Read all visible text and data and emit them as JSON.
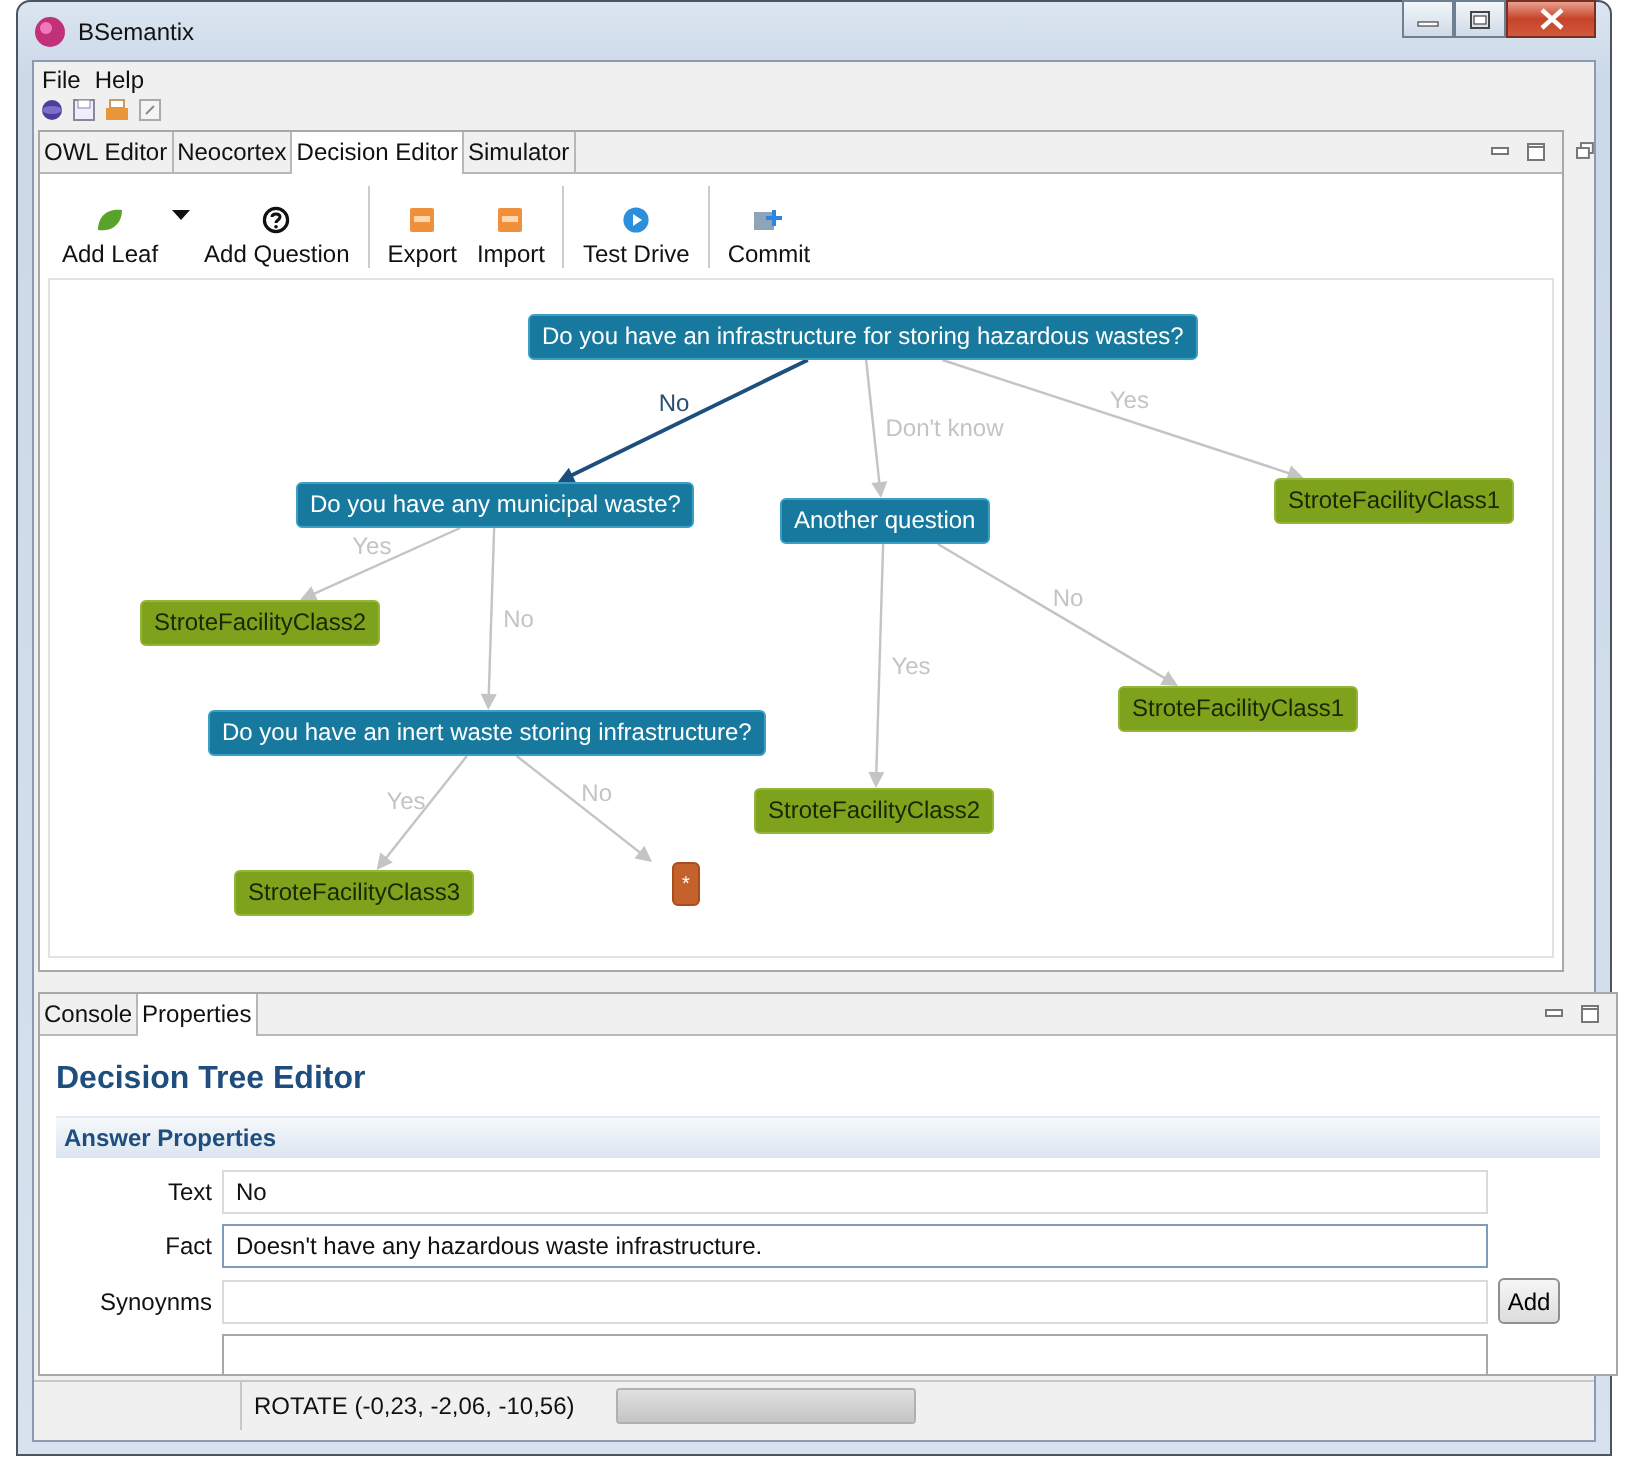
{
  "window": {
    "title": "BSemantix"
  },
  "menu": [
    "File",
    "Help"
  ],
  "editor_tabs": [
    {
      "label": "OWL Editor",
      "selected": false
    },
    {
      "label": "Neocortex",
      "selected": false
    },
    {
      "label": "Decision Editor",
      "selected": true
    },
    {
      "label": "Simulator",
      "selected": false
    }
  ],
  "toolbar": [
    {
      "items": [
        {
          "label": "Add Leaf",
          "dropdown": true
        },
        {
          "label": "Add Question",
          "dropdown": false
        }
      ]
    },
    {
      "items": [
        {
          "label": "Export",
          "dropdown": false
        },
        {
          "label": "Import",
          "dropdown": false
        }
      ]
    },
    {
      "items": [
        {
          "label": "Test Drive",
          "dropdown": false
        }
      ]
    },
    {
      "items": [
        {
          "label": "Commit",
          "dropdown": false
        }
      ]
    }
  ],
  "tree": {
    "kind": "question",
    "text": "Do you have an infrastructure for storing hazardous wastes?",
    "answers": [
      {
        "label": "No",
        "selected": true,
        "node": {
          "kind": "question",
          "text": "Do you have any municipal waste?",
          "answers": [
            {
              "label": "Yes",
              "selected": false,
              "node": {
                "kind": "class",
                "text": "StroteFacilityClass2"
              }
            },
            {
              "label": "No",
              "selected": false,
              "node": {
                "kind": "question",
                "text": "Do you have an inert waste storing infrastructure?",
                "answers": [
                  {
                    "label": "Yes",
                    "selected": false,
                    "node": {
                      "kind": "class",
                      "text": "StroteFacilityClass3"
                    }
                  },
                  {
                    "label": "No",
                    "selected": false,
                    "node": {
                      "kind": "empty",
                      "text": "*"
                    }
                  }
                ]
              }
            }
          ]
        }
      },
      {
        "label": "Don't know",
        "selected": false,
        "node": {
          "kind": "question",
          "text": "Another question",
          "answers": [
            {
              "label": "Yes",
              "selected": false,
              "node": {
                "kind": "class",
                "text": "StroteFacilityClass2"
              }
            },
            {
              "label": "No",
              "selected": false,
              "node": {
                "kind": "class",
                "text": "StroteFacilityClass1"
              }
            }
          ]
        }
      },
      {
        "label": "Yes",
        "selected": false,
        "node": {
          "kind": "class",
          "text": "StroteFacilityClass1"
        }
      }
    ]
  },
  "bottom_tabs": [
    {
      "label": "Console",
      "selected": false
    },
    {
      "label": "Properties",
      "selected": true
    }
  ],
  "properties": {
    "title": "Decision Tree Editor",
    "section": "Answer Properties",
    "fields": [
      {
        "label": "Text",
        "value": "No",
        "focused": false
      },
      {
        "label": "Fact",
        "value": "Doesn't have any hazardous waste infrastructure.",
        "focused": true
      },
      {
        "label": "Synoynms",
        "focused": false,
        "button": "Add"
      }
    ]
  },
  "status_bar": {
    "text": "ROTATE (-0,23, -2,06, -10,56)",
    "progress": {
      "level": 1
    }
  }
}
